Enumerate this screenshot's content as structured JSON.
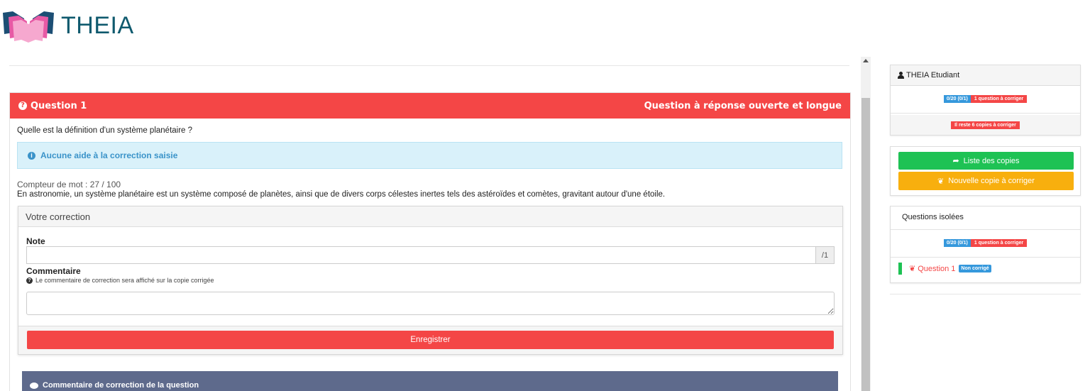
{
  "app": {
    "name": "THEIA"
  },
  "question": {
    "title": "Question 1",
    "type": "Question à réponse ouverte et longue",
    "text": "Quelle est la définition d'un système planétaire ?",
    "hint": "Aucune aide à la correction saisie",
    "word_counter": "Compteur de mot : 27 / 100",
    "answer": "En astronomie, un système planétaire est un système composé de planètes, ainsi que de divers corps célestes inertes tels des astéroïdes et comètes, gravitant autour d'une étoile."
  },
  "correction": {
    "title": "Votre correction",
    "note_label": "Note",
    "note_value": "",
    "note_max": "/1",
    "comment_label": "Commentaire",
    "comment_help": "Le commentaire de correction sera affiché sur la copie corrigée",
    "comment_value": "",
    "save_label": "Enregistrer"
  },
  "comment_section": {
    "title": "Commentaire de correction de la question"
  },
  "sidebar": {
    "user": {
      "name": "THEIA Etudiant",
      "score_badge": "0/20 (0/1)",
      "to_correct_badge": "1 question à corriger",
      "remaining": "Il reste 6 copies à corriger"
    },
    "actions": {
      "list_label": "Liste des copies",
      "new_label": "Nouvelle copie à corriger"
    },
    "isolated": {
      "title": "Questions isolées",
      "score_badge": "0/20 (0/1)",
      "to_correct_badge": "1 question à corriger",
      "items": [
        {
          "label": "Question 1",
          "status": "Non corrigé"
        }
      ]
    }
  },
  "colors": {
    "red": "#f44646",
    "green": "#1ec254",
    "orange": "#f8af0e",
    "blue": "#3598dc",
    "brand": "#0f5a6e"
  }
}
